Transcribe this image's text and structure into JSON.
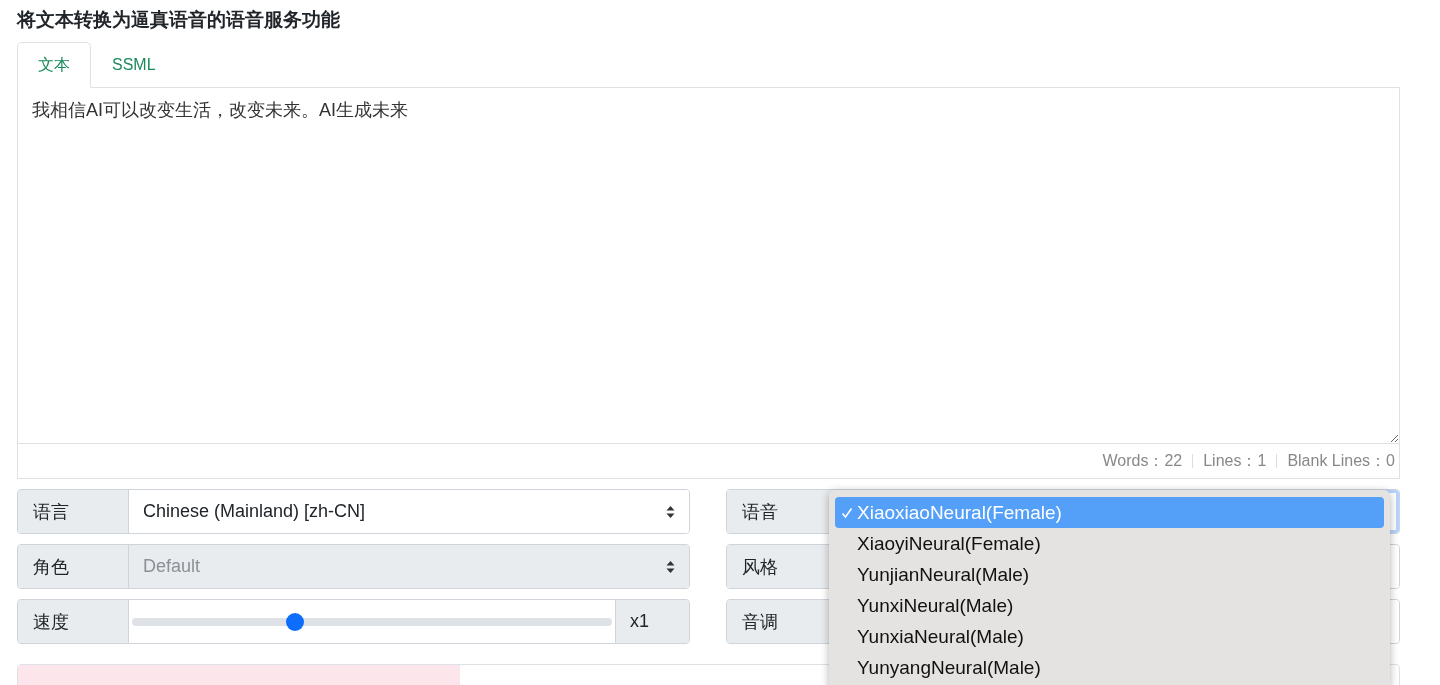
{
  "title": "将文本转换为逼真语音的语音服务功能",
  "tabs": [
    {
      "label": "文本",
      "selected": true
    },
    {
      "label": "SSML",
      "selected": false
    }
  ],
  "text_input": {
    "value": "我相信AI可以改变生活，改变未来。AI生成未来"
  },
  "stats": [
    "Words：22",
    "Lines：1",
    "Blank Lines：0"
  ],
  "left_controls": [
    {
      "kind": "select",
      "label": "语言",
      "value": "Chinese (Mainland) [zh-CN]",
      "disabled": false
    },
    {
      "kind": "select",
      "label": "角色",
      "value": "Default",
      "disabled": true
    },
    {
      "kind": "slider",
      "label": "速度",
      "level": 0.34,
      "reading": "x1"
    }
  ],
  "right_controls": [
    {
      "label": "语音"
    },
    {
      "label": "风格"
    },
    {
      "label": "音调"
    }
  ],
  "voice_dropdown": {
    "options": [
      {
        "label": "XiaoxiaoNeural(Female)",
        "selected": true
      },
      {
        "label": "XiaoyiNeural(Female)",
        "selected": false
      },
      {
        "label": "YunjianNeural(Male)",
        "selected": false
      },
      {
        "label": "YunxiNeural(Male)",
        "selected": false
      },
      {
        "label": "YunxiaNeural(Male)",
        "selected": false
      },
      {
        "label": "YunyangNeural(Male)",
        "selected": false
      }
    ]
  },
  "progress": {
    "level": 0.32
  }
}
